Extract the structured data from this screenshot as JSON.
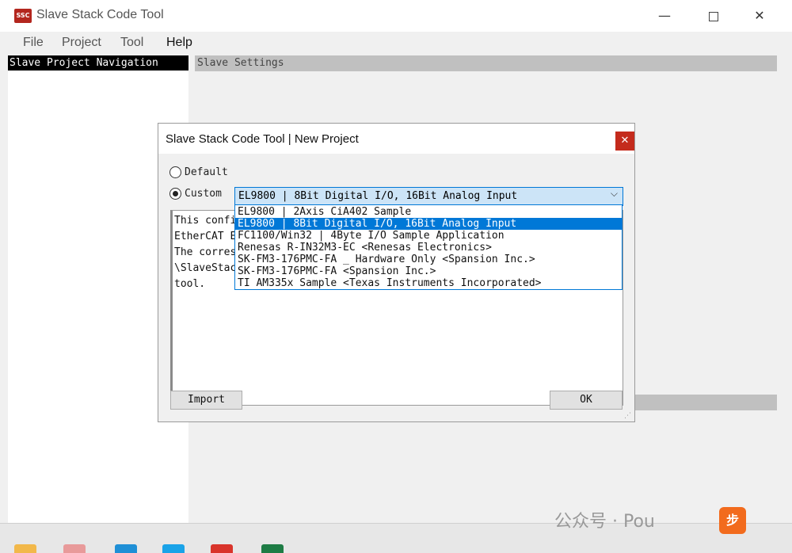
{
  "window": {
    "icon_text": "SSC",
    "title": "Slave Stack Code Tool",
    "min_glyph": "—",
    "close_glyph": "✕"
  },
  "menu": [
    "File",
    "Project",
    "Tool",
    "Help"
  ],
  "panels": {
    "navigation_title": "Slave Project Navigation",
    "settings_title": "Slave Settings"
  },
  "dialog": {
    "title": "Slave Stack Code Tool | New Project",
    "close_glyph": "✕",
    "radio_default": "Default",
    "radio_custom": "Custom",
    "selected_option": "EL9800 | 8Bit Digital I/O, 16Bit Analog Input",
    "combo_arrow": "⌵",
    "options": [
      "EL9800 | 2Axis CiA402 Sample",
      "EL9800 | 8Bit Digital I/O, 16Bit Analog Input",
      "FC1100/Win32 | 4Byte I/O Sample Application",
      "Renesas R-IN32M3-EC <Renesas Electronics>",
      "SK-FM3-176PMC-FA _ Hardware Only <Spansion Inc.>",
      "SK-FM3-176PMC-FA <Spansion Inc.>",
      "TI AM335x Sample <Texas Instruments Incorporated>"
    ],
    "description_lines": [
      "This confi",
      "EtherCAT Ev",
      "The corresp",
      "\\SlaveStack",
      "tool."
    ],
    "import_label": "Import",
    "ok_label": "OK"
  },
  "watermark": {
    "text": "公众号 · Pou",
    "badge": "步"
  },
  "colors": {
    "accent": "#0078d7",
    "dialog_close": "#c42b1c",
    "app_icon": "#b3261e"
  }
}
